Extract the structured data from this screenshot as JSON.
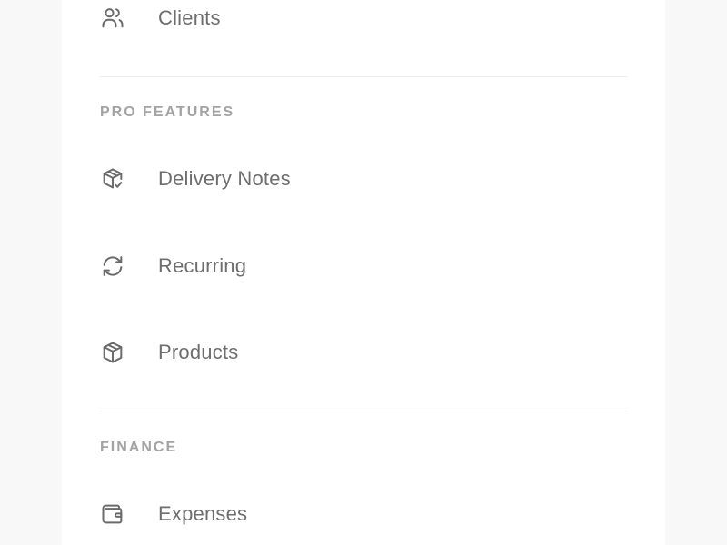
{
  "sidebar": {
    "items": {
      "clients": {
        "label": "Clients",
        "icon": "users-icon"
      },
      "delivery_notes": {
        "label": "Delivery Notes",
        "icon": "package-check-icon"
      },
      "recurring": {
        "label": "Recurring",
        "icon": "refresh-icon"
      },
      "products": {
        "label": "Products",
        "icon": "box-icon"
      },
      "expenses": {
        "label": "Expenses",
        "icon": "wallet-icon"
      }
    },
    "sections": {
      "pro_features": "PRO FEATURES",
      "finance": "FINANCE"
    }
  },
  "colors": {
    "page_bg": "#f8f8f8",
    "panel_bg": "#ffffff",
    "item_text": "#6e6e6e",
    "icon_stroke": "#6b6b6b",
    "section_text": "#a3a3a3",
    "divider": "#ececec"
  }
}
